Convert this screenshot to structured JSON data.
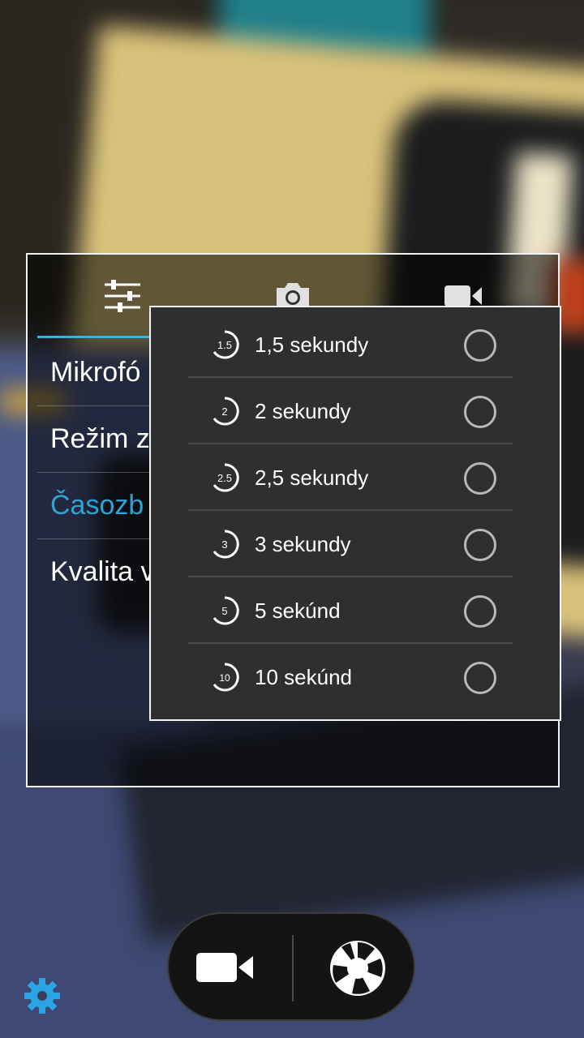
{
  "screen": "camera-settings-timelapse",
  "settings_panel": {
    "tabs": [
      {
        "name": "general",
        "icon": "sliders-icon",
        "selected": true
      },
      {
        "name": "photo",
        "icon": "camera-icon",
        "selected": false
      },
      {
        "name": "video",
        "icon": "videocam-icon",
        "selected": false
      }
    ],
    "items": [
      {
        "label": "Mikrofó",
        "active": false
      },
      {
        "label": "Režim z",
        "active": false
      },
      {
        "label": "Časozb",
        "active": true
      },
      {
        "label": "Kvalita v",
        "active": false
      }
    ]
  },
  "timelapse_popup": {
    "options": [
      {
        "badge": "1.5",
        "label": "1,5 sekundy",
        "checked": false
      },
      {
        "badge": "2",
        "label": "2 sekundy",
        "checked": false
      },
      {
        "badge": "2.5",
        "label": "2,5 sekundy",
        "checked": false
      },
      {
        "badge": "3",
        "label": "3 sekundy",
        "checked": false
      },
      {
        "badge": "5",
        "label": "5 sekúnd",
        "checked": false
      },
      {
        "badge": "10",
        "label": "10 sekúnd",
        "checked": false
      }
    ]
  },
  "controls": {
    "video_icon": "videocam-icon",
    "shutter_icon": "shutter-icon",
    "settings_icon": "gear-icon"
  },
  "colors": {
    "accent": "#33b5e5",
    "active_item": "#2ea3d4",
    "gear": "#2aa4e4",
    "popup_bg": "#2f2f2f"
  }
}
